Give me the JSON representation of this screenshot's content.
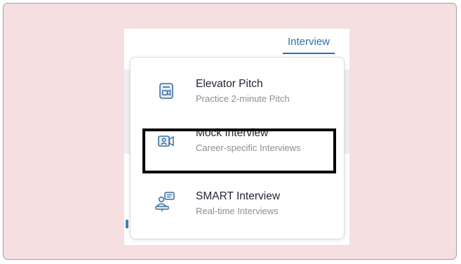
{
  "nav": {
    "active_tab": "Interview"
  },
  "menu": {
    "items": [
      {
        "title": "Elevator Pitch",
        "subtitle": "Practice 2-minute Pitch",
        "icon": "elevator-pitch-video-icon"
      },
      {
        "title": "Mock Interview",
        "subtitle": "Career-specific Interviews",
        "icon": "mock-interview-video-call-icon",
        "highlighted": true
      },
      {
        "title": "SMART Interview",
        "subtitle": "Real-time Interviews",
        "icon": "smart-interview-people-chat-icon"
      }
    ]
  },
  "colors": {
    "accent": "#2f6fb6",
    "icon": "#3a6f9e",
    "frame_background": "#f5dfe0",
    "highlight_border": "#000000"
  }
}
